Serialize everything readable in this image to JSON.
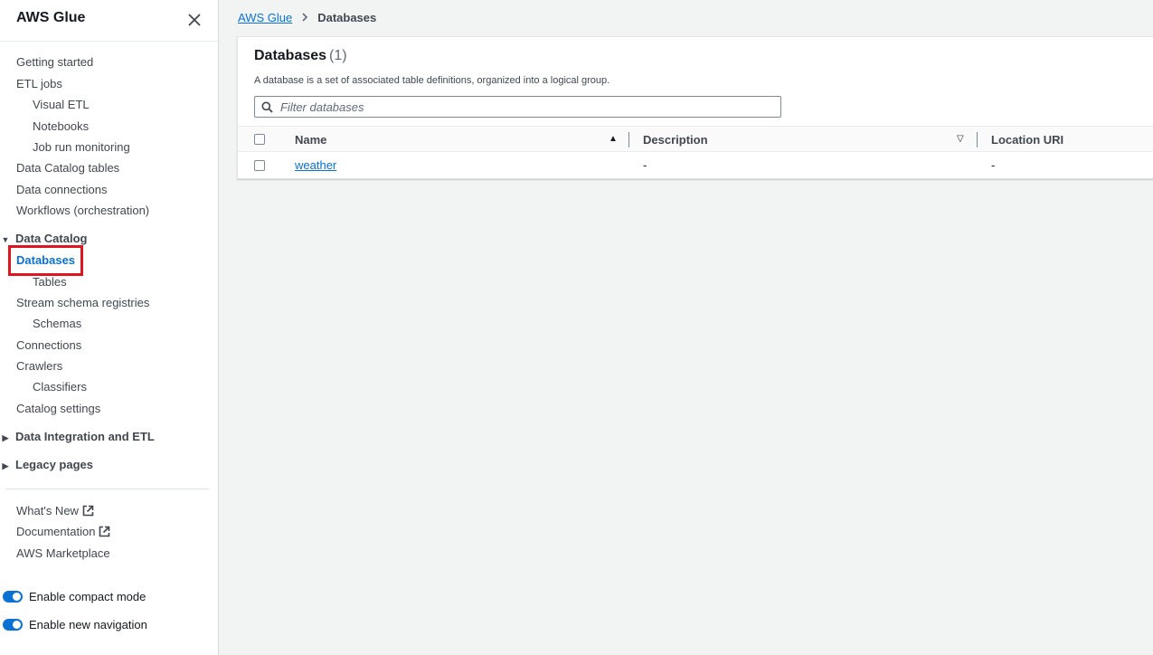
{
  "sidebar": {
    "title": "AWS Glue",
    "items": [
      {
        "label": "Getting started"
      },
      {
        "label": "ETL jobs"
      },
      {
        "label": "Visual ETL"
      },
      {
        "label": "Notebooks"
      },
      {
        "label": "Job run monitoring"
      },
      {
        "label": "Data Catalog tables"
      },
      {
        "label": "Data connections"
      },
      {
        "label": "Workflows (orchestration)"
      }
    ],
    "data_catalog": {
      "label": "Data Catalog",
      "items": [
        {
          "label": "Databases"
        },
        {
          "label": "Tables"
        },
        {
          "label": "Stream schema registries"
        },
        {
          "label": "Schemas"
        },
        {
          "label": "Connections"
        },
        {
          "label": "Crawlers"
        },
        {
          "label": "Classifiers"
        },
        {
          "label": "Catalog settings"
        }
      ]
    },
    "data_integration": {
      "label": "Data Integration and ETL"
    },
    "legacy": {
      "label": "Legacy pages"
    },
    "footer_links": [
      {
        "label": "What's New"
      },
      {
        "label": "Documentation"
      },
      {
        "label": "AWS Marketplace"
      }
    ],
    "toggles": [
      {
        "label": "Enable compact mode",
        "on": true
      },
      {
        "label": "Enable new navigation",
        "on": true
      }
    ]
  },
  "breadcrumb": {
    "root": "AWS Glue",
    "current": "Databases"
  },
  "panel": {
    "title": "Databases",
    "count": "(1)",
    "description": "A database is a set of associated table definitions, organized into a logical group.",
    "search_placeholder": "Filter databases"
  },
  "table": {
    "columns": [
      "Name",
      "Description",
      "Location URI"
    ],
    "rows": [
      {
        "name": "weather",
        "description": "-",
        "location_uri": "-"
      }
    ]
  },
  "colors": {
    "accent": "#0972d3",
    "highlight": "#e0151f"
  }
}
